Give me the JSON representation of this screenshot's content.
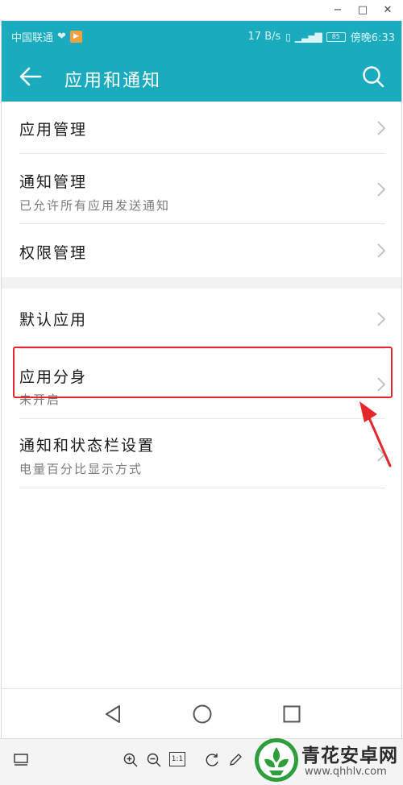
{
  "window": {
    "minimize_glyph": "−",
    "maximize_glyph": "□",
    "close_glyph": "✕"
  },
  "status_bar": {
    "carrier": "中国联通",
    "speed": "17 B/s",
    "battery": "85",
    "time": "傍晚6:33",
    "color": "#1aabbf"
  },
  "header": {
    "title": "应用和通知",
    "back_icon": "arrow-left-icon",
    "search_icon": "search-icon"
  },
  "settings": {
    "group1": [
      {
        "title": "应用管理",
        "subtitle": ""
      },
      {
        "title": "通知管理",
        "subtitle": "已允许所有应用发送通知"
      },
      {
        "title": "权限管理",
        "subtitle": ""
      }
    ],
    "group2": [
      {
        "title": "默认应用",
        "subtitle": ""
      },
      {
        "title": "应用分身",
        "subtitle": "未开启"
      },
      {
        "title": "通知和状态栏设置",
        "subtitle": "电量百分比显示方式"
      }
    ]
  },
  "annotation": {
    "highlight_color": "#e5262a"
  },
  "nav": {
    "back": "nav-back-icon",
    "home": "nav-home-icon",
    "recent": "nav-recent-icon"
  },
  "viewer_toolbar": {
    "one_to_one": "1:1"
  },
  "watermark": {
    "brand": "青花安卓网",
    "url": "www.qhhlv.com"
  }
}
